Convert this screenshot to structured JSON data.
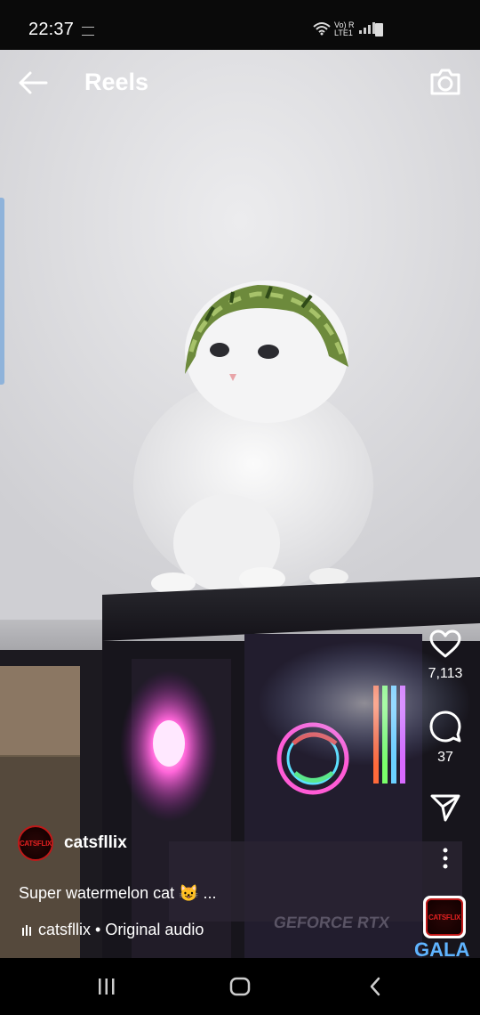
{
  "status_bar": {
    "time": "22:37",
    "network": "Vo) R\nLTE1"
  },
  "header": {
    "title": "Reels",
    "back_icon": "arrow-left-icon",
    "camera_icon": "camera-icon"
  },
  "actions": {
    "likes": "7,113",
    "comments": "37"
  },
  "post": {
    "username": "catsfllix",
    "avatar_text": "CATSFLIX",
    "caption": "Super watermelon cat 😺 ...",
    "audio": "catsfllix • Original audio",
    "thumb_text": "CATSFLIX"
  },
  "video_overlay": {
    "gpu_text": "GEFORCE RTX",
    "brand_text": "GALA"
  },
  "colors": {
    "edge_tab": "#8fb3da",
    "avatar_ring": "#c01818"
  }
}
